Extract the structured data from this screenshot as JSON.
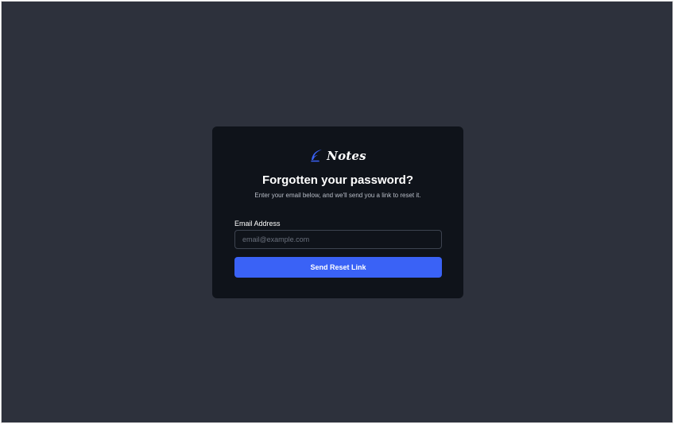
{
  "brand": {
    "name": "Notes",
    "icon": "feather-icon",
    "accent_color": "#3a62f6"
  },
  "reset_form": {
    "title": "Forgotten your password?",
    "subtitle": "Enter your email below, and we'll send you a link to reset it.",
    "email_label": "Email Address",
    "email_placeholder": "email@example.com",
    "email_value": "",
    "submit_label": "Send Reset Link"
  },
  "colors": {
    "page_background": "#2d313c",
    "card_background": "#0f131a",
    "button_background": "#3a62f6"
  }
}
